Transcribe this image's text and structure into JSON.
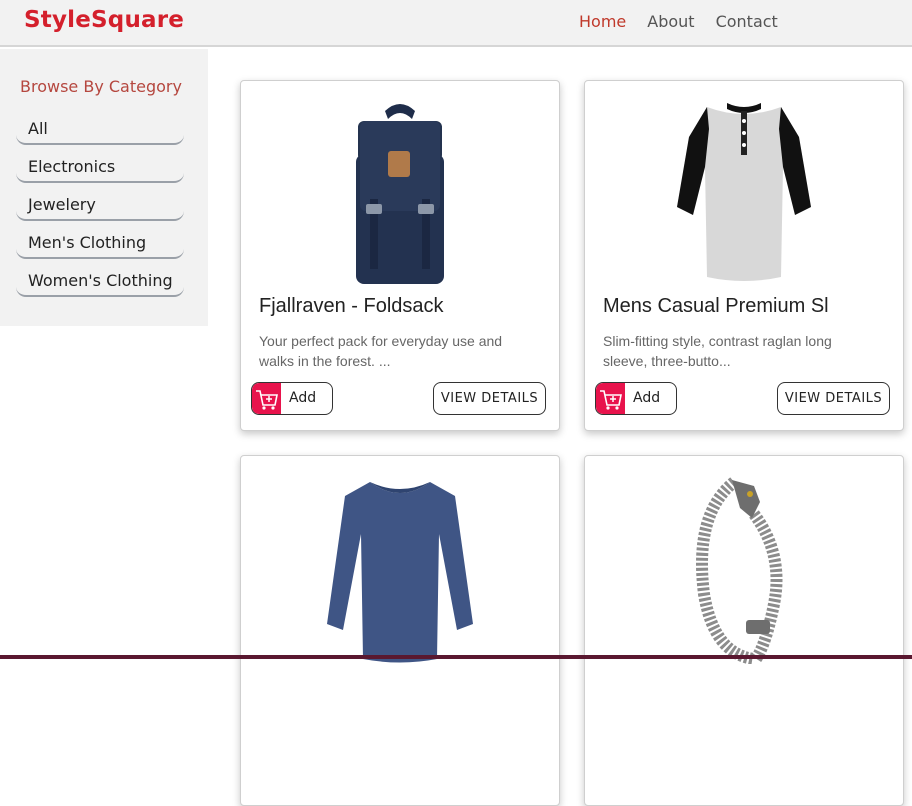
{
  "brand": "StyleSquare",
  "nav": {
    "home": "Home",
    "about": "About",
    "contact": "Contact"
  },
  "sidebar": {
    "title": "Browse By Category",
    "items": [
      "All",
      "Electronics",
      "Jewelery",
      "Men's Clothing",
      "Women's Clothing"
    ]
  },
  "products": [
    {
      "title": "Fjallraven - Foldsack",
      "desc": "Your perfect pack for everyday use and walks in the forest. ...",
      "add": "Add",
      "details": "VIEW DETAILS"
    },
    {
      "title": "Mens Casual Premium Sl",
      "desc": "Slim-fitting style, contrast raglan long sleeve, three-butto...",
      "add": "Add",
      "details": "VIEW DETAILS"
    },
    {
      "title": "",
      "desc": "",
      "add": "",
      "details": ""
    },
    {
      "title": "",
      "desc": "",
      "add": "",
      "details": ""
    }
  ],
  "colors": {
    "brand": "#d4202c",
    "accent": "#e8134c"
  }
}
